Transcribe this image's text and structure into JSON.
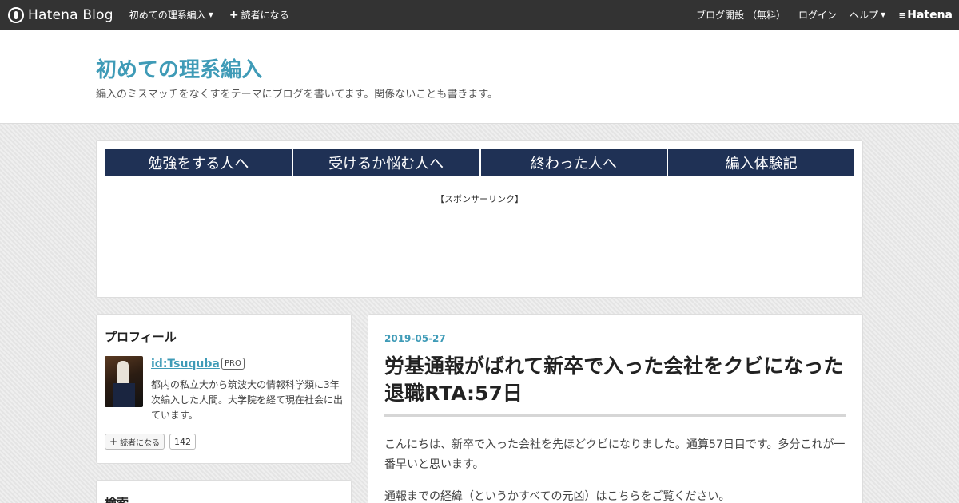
{
  "topbar": {
    "brand": "Hatena Blog",
    "blog_menu": "初めての理系編入",
    "subscribe": "読者になる",
    "open_blog": "ブログ開設 （無料）",
    "login": "ログイン",
    "help": "ヘルプ",
    "hatena": "Hatena"
  },
  "header": {
    "title": "初めての理系編入",
    "description": "編入のミスマッチをなくすをテーマにブログを書いてます。関係ないことも書きます。"
  },
  "nav": {
    "tabs": [
      {
        "label": "勉強をする人へ"
      },
      {
        "label": "受けるか悩む人へ"
      },
      {
        "label": "終わった人へ"
      },
      {
        "label": "編入体験記"
      }
    ],
    "sponsor": "【スポンサーリンク】"
  },
  "profile": {
    "title": "プロフィール",
    "id": "id:Tsuquba",
    "badge": "PRO",
    "bio": "都内の私立大から筑波大の情報科学類に3年次編入した人間。大学院を経て現在社会に出ています。",
    "follow_label": "読者になる",
    "follow_count": "142"
  },
  "search": {
    "title": "検索"
  },
  "article": {
    "date": "2019-05-27",
    "title": "労基通報がばれて新卒で入った会社をクビになった 退職RTA:57日",
    "para1": "こんにちは、新卒で入った会社を先ほどクビになりました。通算57日目です。多分これが一番早いと思います。",
    "para2": "通報までの経緯（というかすべての元凶）はこちらをご覧ください。"
  },
  "colors": {
    "topbar": "#333333",
    "accent": "#3f9bb7",
    "nav_tab": "#1f3155"
  }
}
